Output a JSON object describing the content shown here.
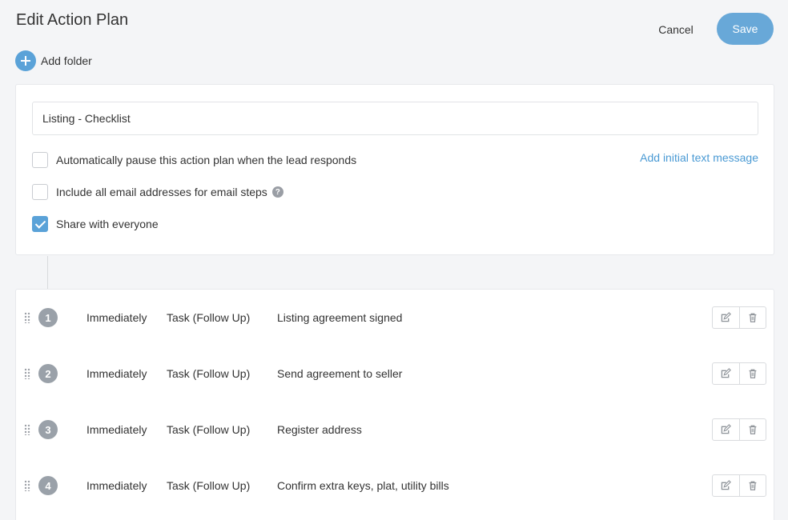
{
  "header": {
    "title": "Edit Action Plan",
    "cancel_label": "Cancel",
    "save_label": "Save"
  },
  "toolbar": {
    "add_folder_label": "Add folder"
  },
  "settings": {
    "plan_name": "Listing - Checklist",
    "pause_label": "Automatically pause this action plan when the lead responds",
    "pause_checked": false,
    "include_email_label": "Include all email addresses for email steps",
    "include_email_checked": false,
    "share_label": "Share with everyone",
    "share_checked": true,
    "add_text_message_label": "Add initial text message"
  },
  "steps": [
    {
      "number": "1",
      "when": "Immediately",
      "type": "Task (Follow Up)",
      "description": "Listing agreement signed"
    },
    {
      "number": "2",
      "when": "Immediately",
      "type": "Task (Follow Up)",
      "description": "Send agreement to seller"
    },
    {
      "number": "3",
      "when": "Immediately",
      "type": "Task (Follow Up)",
      "description": "Register address"
    },
    {
      "number": "4",
      "when": "Immediately",
      "type": "Task (Follow Up)",
      "description": "Confirm extra keys, plat, utility bills"
    }
  ],
  "icons": {
    "edit": "edit-icon",
    "delete": "trash-icon",
    "drag": "drag-handle-icon",
    "help": "question-icon",
    "add": "plus-icon"
  },
  "colors": {
    "accent": "#5aa2d8",
    "save_button": "#68a8d8",
    "link": "#4a9ad4",
    "step_badge": "#9aa1a9"
  }
}
